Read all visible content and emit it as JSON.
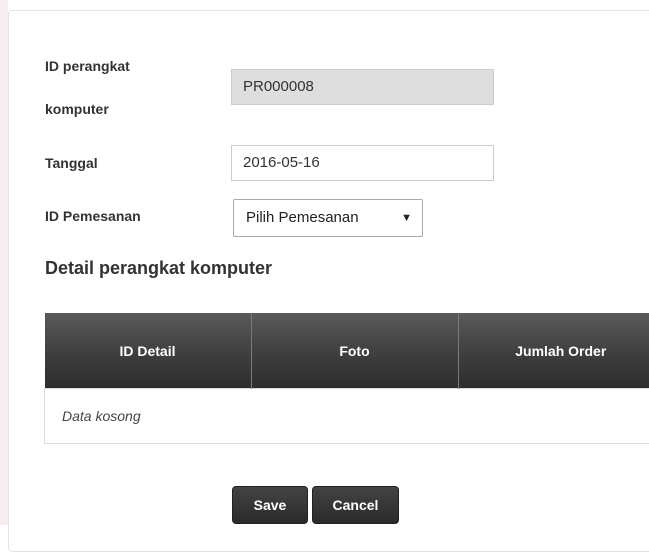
{
  "form": {
    "id_label_line1": "ID perangkat",
    "id_label_line2": "komputer",
    "id_value": "PR000008",
    "date_label": "Tanggal",
    "date_value": "2016-05-16",
    "order_label": "ID Pemesanan",
    "order_selected": "Pilih Pemesanan"
  },
  "detail": {
    "title": "Detail perangkat komputer",
    "columns": [
      "ID Detail",
      "Foto",
      "Jumlah Order"
    ],
    "empty_text": "Data kosong"
  },
  "actions": {
    "save_label": "Save",
    "cancel_label": "Cancel"
  },
  "icons": {
    "dropdown": "triangle-down"
  }
}
